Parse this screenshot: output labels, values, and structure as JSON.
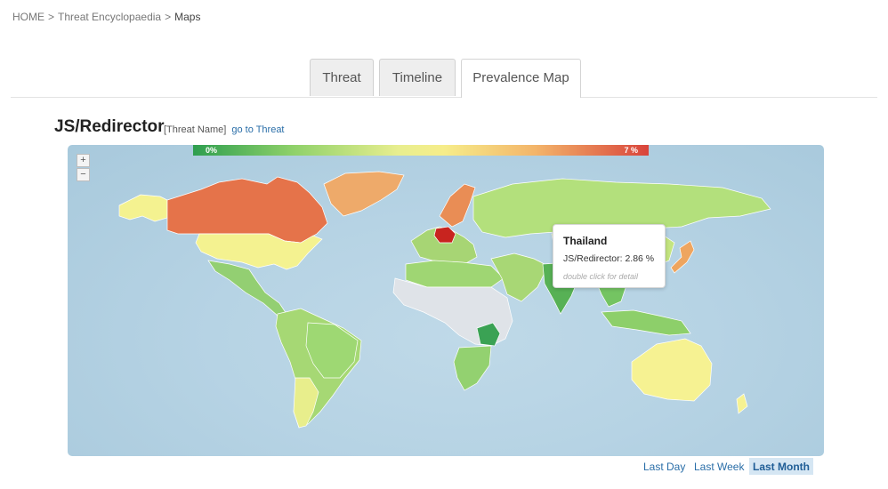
{
  "breadcrumb": {
    "home": "HOME",
    "separator": ">",
    "encyclopaedia": "Threat Encyclopaedia",
    "current": "Maps"
  },
  "tabs": [
    {
      "label": "Threat",
      "active": false
    },
    {
      "label": "Timeline",
      "active": false
    },
    {
      "label": "Prevalence Map",
      "active": true
    }
  ],
  "threat": {
    "name": "JS/Redirector",
    "type_label": "[Threat Name]",
    "link_label": "go to Threat"
  },
  "legend": {
    "min_label": "0%",
    "max_label": "7 %",
    "low_color": "#2e9e4f",
    "mid_color": "#f6ed8a",
    "high_color": "#d9443b",
    "no_data_color": "#dfe3e8"
  },
  "zoom": {
    "in_label": "+",
    "out_label": "−"
  },
  "tooltip": {
    "country": "Thailand",
    "value": "JS/Redirector: 2.86 %",
    "hint": "double click for detail"
  },
  "periods": {
    "day": "Last Day",
    "week": "Last Week",
    "month": "Last Month",
    "selected": "Last Month"
  },
  "prevalence_colors": {
    "north_america_us": "#f4f290",
    "alaska": "#f4f290",
    "canada": "#e5734a",
    "greenland": "#eeaa6a",
    "mexico_central": "#93cf72",
    "south_america": "#a6d874",
    "brazil": "#9ed873",
    "chile_argentina": "#e8ee8c",
    "europe_west": "#a7d574",
    "germany": "#c8241f",
    "scandinavia": "#e98d55",
    "russia": "#b3e07c",
    "africa_north": "#9fd673",
    "africa_central": "#dfe3e8",
    "tanzania": "#3aa254",
    "middle_east": "#a8d775",
    "india": "#57b155",
    "china": "#c4e580",
    "japan": "#eea55f",
    "se_asia": "#74c462",
    "indonesia": "#8dcf6a",
    "australia": "#f6f292",
    "new_zealand": "#f6f292",
    "south_africa": "#93d170"
  }
}
